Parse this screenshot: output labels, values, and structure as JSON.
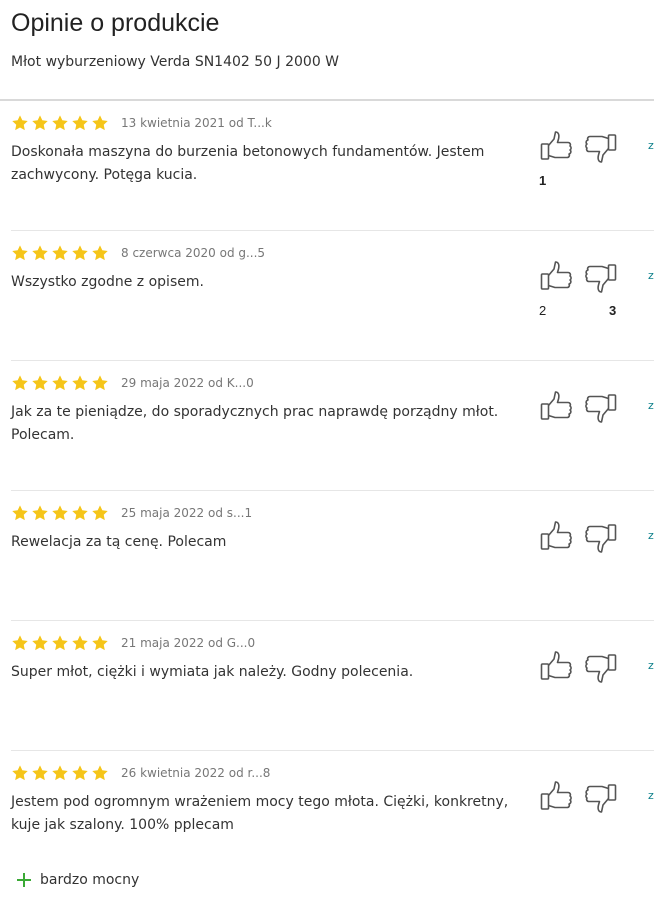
{
  "page": {
    "title": "Opinie o produkcie",
    "product_name": "Młot wyburzeniowy Verda SN1402 50 J 2000 W"
  },
  "colors": {
    "star": "#f5c518",
    "icon_stroke": "#555555",
    "pro_plus": "#3aa935",
    "report_link": "#0a7f8a"
  },
  "icons": {
    "star": "star-icon",
    "vote_up": "thumb-up-icon",
    "vote_down": "thumb-down-icon",
    "pro": "plus-icon"
  },
  "reviews": [
    {
      "rating": 5,
      "date_author": "13 kwietnia 2021 od T...k",
      "text": "Doskonała maszyna do burzenia betonowych fundamentów. Jestem zachwycony. Potęga kucia.",
      "up_votes": "1",
      "down_votes": "",
      "report": "z"
    },
    {
      "rating": 5,
      "date_author": "8 czerwca 2020 od g...5",
      "text": "Wszystko zgodne z opisem.",
      "up_votes": "2",
      "down_votes": "3",
      "report": "z"
    },
    {
      "rating": 5,
      "date_author": "29 maja 2022 od K...0",
      "text": "Jak za te pieniądze, do sporadycznych prac naprawdę porządny młot. Polecam.",
      "up_votes": "",
      "down_votes": "",
      "report": "z"
    },
    {
      "rating": 5,
      "date_author": "25 maja 2022 od s...1",
      "text": "Rewelacja za tą cenę. Polecam",
      "up_votes": "",
      "down_votes": "",
      "report": "z"
    },
    {
      "rating": 5,
      "date_author": "21 maja 2022 od G...0",
      "text": "Super młot, ciężki i wymiata jak należy. Godny polecenia.",
      "up_votes": "",
      "down_votes": "",
      "report": "z"
    },
    {
      "rating": 5,
      "date_author": "26 kwietnia 2022 od r...8",
      "text": "Jestem pod ogromnym wrażeniem mocy tego młota. Ciężki, konkretny, kuje jak szalony. 100% pplecam",
      "up_votes": "",
      "down_votes": "",
      "report": "z",
      "pros": [
        "bardzo mocny"
      ]
    }
  ]
}
